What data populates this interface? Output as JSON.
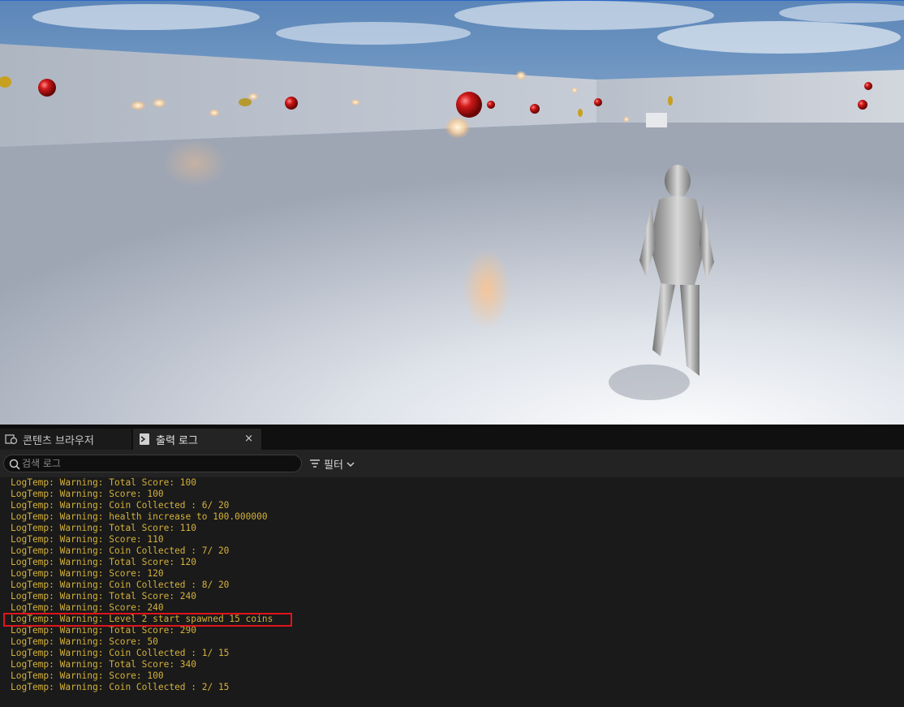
{
  "tabs": [
    {
      "label": "콘텐츠 브라우저",
      "icon": "content-browser-icon",
      "active": false
    },
    {
      "label": "출력 로그",
      "icon": "output-log-icon",
      "active": true,
      "close": "×"
    }
  ],
  "toolbar": {
    "search_placeholder": "검색 로그",
    "search_value": "",
    "filter_label": "필터"
  },
  "log": {
    "lines": [
      "LogTemp: Warning: Total Score: 100",
      "LogTemp: Warning: Score: 100",
      "LogTemp: Warning: Coin Collected : 6/ 20",
      "LogTemp: Warning: health increase to 100.000000",
      "LogTemp: Warning: Total Score: 110",
      "LogTemp: Warning: Score: 110",
      "LogTemp: Warning: Coin Collected : 7/ 20",
      "LogTemp: Warning: Total Score: 120",
      "LogTemp: Warning: Score: 120",
      "LogTemp: Warning: Coin Collected : 8/ 20",
      "LogTemp: Warning: Total Score: 240",
      "LogTemp: Warning: Score: 240",
      "LogTemp: Warning: Level 2 start spawned 15 coins",
      "LogTemp: Warning: Total Score: 290",
      "LogTemp: Warning: Score: 50",
      "LogTemp: Warning: Coin Collected : 1/ 15",
      "LogTemp: Warning: Total Score: 340",
      "LogTemp: Warning: Score: 100",
      "LogTemp: Warning: Coin Collected : 2/ 15"
    ],
    "highlighted_index": 12,
    "text_color": "#d4b13a",
    "highlight_color": "#e0141b"
  }
}
